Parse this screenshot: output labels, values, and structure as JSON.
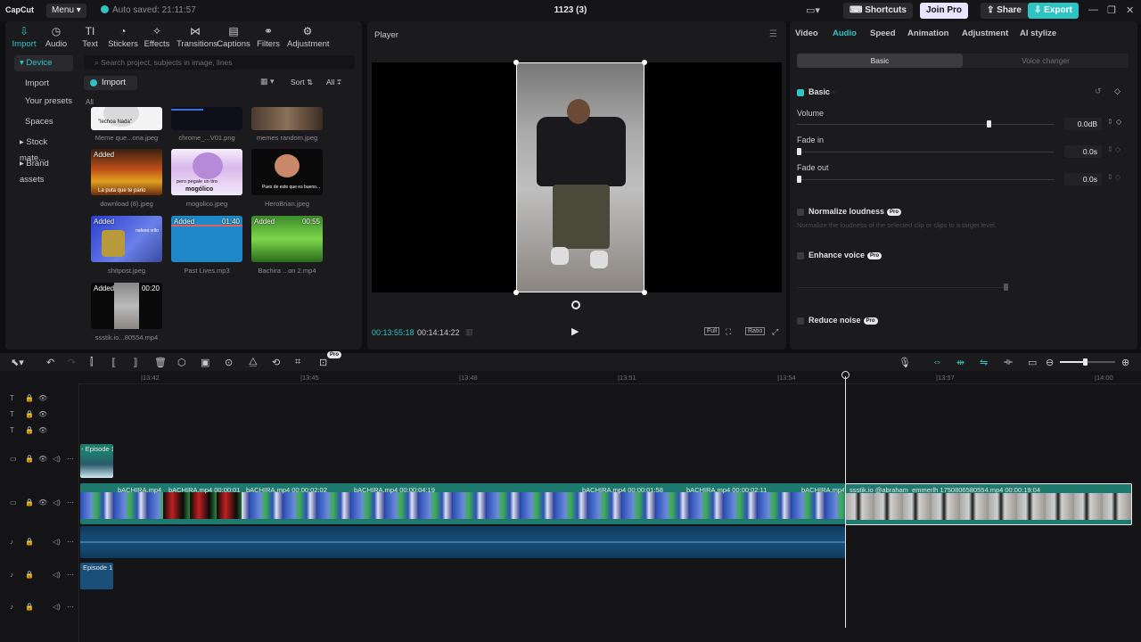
{
  "topbar": {
    "logo": "CapCut",
    "menu": "Menu",
    "autosave": "Auto saved: 21:11:57",
    "project": "1123 (3)",
    "shortcuts": "Shortcuts",
    "join_pro": "Join Pro",
    "share": "Share",
    "export": "Export"
  },
  "tools": [
    {
      "label": "Import",
      "icon": "import-icon"
    },
    {
      "label": "Audio",
      "icon": "audio-icon"
    },
    {
      "label": "Text",
      "icon": "text-icon"
    },
    {
      "label": "Stickers",
      "icon": "stickers-icon"
    },
    {
      "label": "Effects",
      "icon": "effects-icon"
    },
    {
      "label": "Transitions",
      "icon": "transitions-icon"
    },
    {
      "label": "Captions",
      "icon": "captions-icon"
    },
    {
      "label": "Filters",
      "icon": "filters-icon"
    },
    {
      "label": "Adjustment",
      "icon": "adjustment-icon"
    }
  ],
  "sidebar": [
    "Device",
    "Import",
    "Your presets",
    "Spaces",
    "Stock mate...",
    "Brand assets"
  ],
  "media": {
    "search_placeholder": "Search project, subjects in image, lines",
    "import": "Import",
    "sort": "Sort",
    "all": "All",
    "all_label": "All",
    "items": [
      {
        "caption": "Meme que...ona.jpeg",
        "added": "",
        "dur": ""
      },
      {
        "caption": "chrome_...V01.png",
        "added": "",
        "dur": ""
      },
      {
        "caption": "memes random.jpeg",
        "added": "",
        "dur": ""
      },
      {
        "caption": "download (8).jpeg",
        "added": "Added",
        "dur": ""
      },
      {
        "caption": "mogolico.jpeg",
        "added": "",
        "dur": ""
      },
      {
        "caption": "HeroBrian.jpeg",
        "added": "",
        "dur": ""
      },
      {
        "caption": "shitpost.jpeg",
        "added": "Added",
        "dur": ""
      },
      {
        "caption": "Past Lives.mp3",
        "added": "Added",
        "dur": "01:40"
      },
      {
        "caption": "Bachira ...on 2.mp4",
        "added": "Added",
        "dur": "00:55"
      },
      {
        "caption": "ssstik.io...80554.mp4",
        "added": "Added",
        "dur": "00:20"
      }
    ],
    "thumb_texts": [
      "\"lechoa Nada\"",
      "La puta que te pario",
      "pero pegale un tiro",
      "mogólico",
      "Pues de este que es bueno...",
      "nafeea vrllo"
    ]
  },
  "player": {
    "title": "Player",
    "current": "00:13:55:18",
    "total": "00:14:14:22",
    "ratio": "Ratio",
    "full": "Full"
  },
  "props": {
    "tabs": [
      "Video",
      "Audio",
      "Speed",
      "Animation",
      "Adjustment",
      "AI stylize"
    ],
    "seg_basic": "Basic",
    "seg_voice": "Voice changer",
    "basic": "Basic",
    "volume_label": "Volume",
    "volume": "0.0dB",
    "fade_in_label": "Fade in",
    "fade_in": "0.0s",
    "fade_out_label": "Fade out",
    "fade_out": "0.0s",
    "normalize": "Normalize loudness",
    "normalize_desc": "Normalize the loudness of the selected clip or clips to a target level.",
    "enhance": "Enhance voice",
    "reduce": "Reduce noise",
    "pro": "Pro",
    "accent": "#2ec4c4",
    "volume_level": 0.74
  },
  "timeline": {
    "ruler": [
      "|13:42",
      "|13:45",
      "|13:48",
      "|13:51",
      "|13:54",
      "|13:57",
      "|14:00"
    ],
    "clips": [
      {
        "label": "bACHIRA.mp4"
      },
      {
        "label": "bACHIRA.mp4  00:00:01"
      },
      {
        "label": "bACHIRA.mp4  00:00:02:02"
      },
      {
        "label": "bACHIRA.mp4  00:00:04:19"
      },
      {
        "label": "bACHIRA.mp4  00:00:01:58"
      },
      {
        "label": "bACHIRA.mp4  00:00:02:11"
      },
      {
        "label": "bACHIRA.mp4"
      },
      {
        "label": "ssstik.io  @abraham_emmerlh  1750806580554.mp4  00:00:19:04"
      }
    ],
    "episode1": "- Episode 1",
    "episode1_audio": "Episode 1"
  }
}
